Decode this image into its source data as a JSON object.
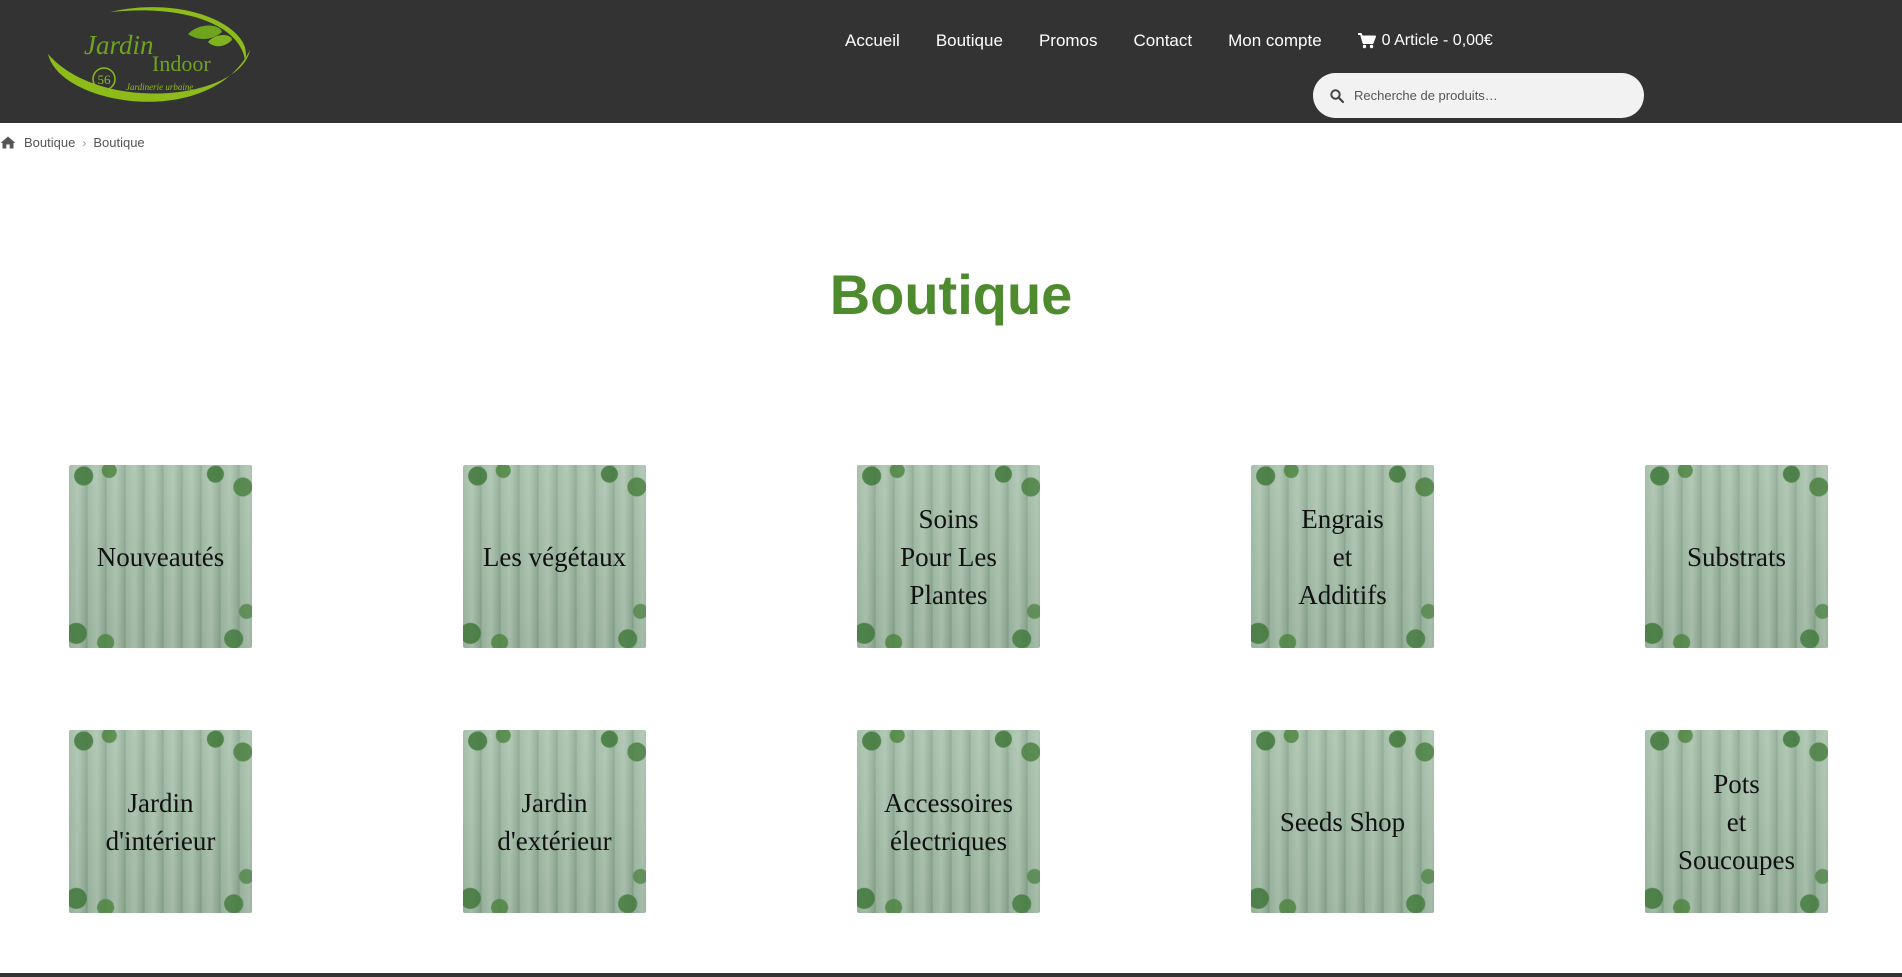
{
  "header": {
    "logo": {
      "line1": "Jardin",
      "line2": "Indoor",
      "badge": "56",
      "tagline": "Jardinerie urbaine"
    },
    "nav": [
      {
        "label": "Accueil"
      },
      {
        "label": "Boutique"
      },
      {
        "label": "Promos"
      },
      {
        "label": "Contact"
      },
      {
        "label": "Mon compte"
      }
    ],
    "cart": {
      "label": "0 Article - 0,00€",
      "icon": "cart-icon"
    },
    "search": {
      "placeholder": "Recherche de produits…",
      "icon": "search-icon"
    }
  },
  "breadcrumb": {
    "home_label": "Boutique",
    "current": "Boutique",
    "icon": "home-icon"
  },
  "page": {
    "title": "Boutique"
  },
  "categories": [
    {
      "label": "Nouveautés"
    },
    {
      "label": "Les végétaux"
    },
    {
      "label": "Soins\nPour Les\nPlantes"
    },
    {
      "label": "Engrais\net\nAdditifs"
    },
    {
      "label": "Substrats"
    },
    {
      "label": "Jardin\nd'intérieur"
    },
    {
      "label": "Jardin\nd'extérieur"
    },
    {
      "label": "Accessoires\nélectriques"
    },
    {
      "label": "Seeds Shop"
    },
    {
      "label": "Pots\net\nSoucoupes"
    }
  ],
  "colors": {
    "header_bg": "#333333",
    "title_green": "#4e8a2e",
    "logo_green": "#8dbb1a"
  }
}
